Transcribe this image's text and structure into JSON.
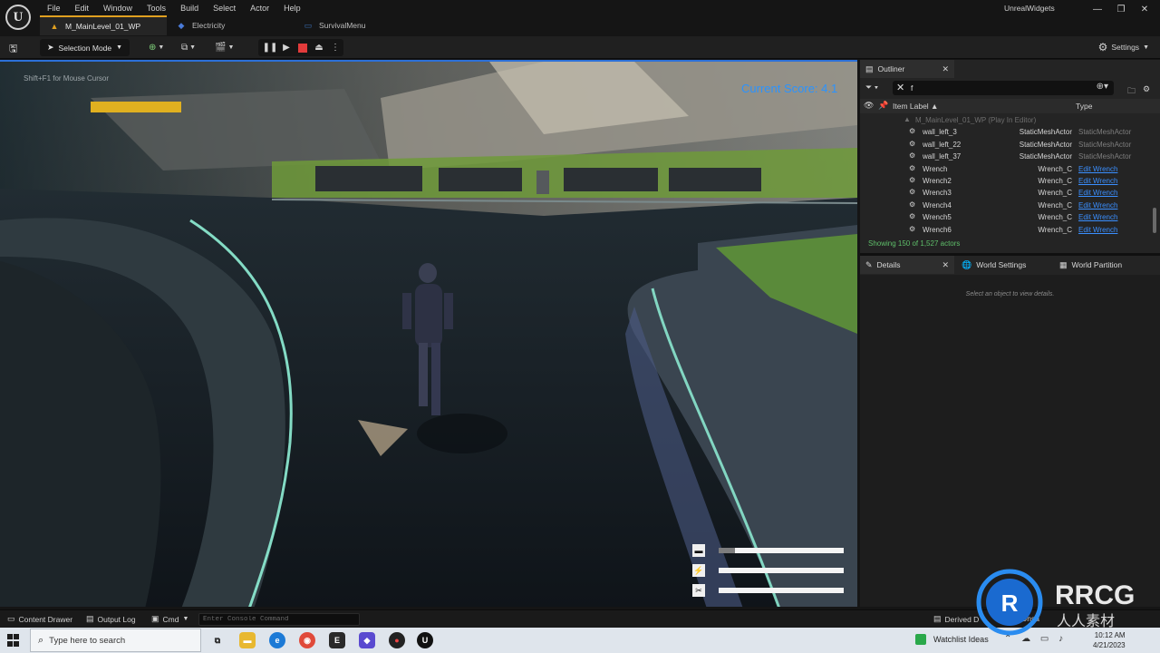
{
  "titlebar": {
    "logo": "U",
    "menu": [
      "File",
      "Edit",
      "Window",
      "Tools",
      "Build",
      "Select",
      "Actor",
      "Help"
    ],
    "tabs": [
      {
        "label": "M_MainLevel_01_WP",
        "icon": "level-icon",
        "active": true
      },
      {
        "label": "Electricity",
        "icon": "blueprint-icon",
        "active": false
      },
      {
        "label": "SurvivalMenu",
        "icon": "widget-icon",
        "active": false
      }
    ],
    "window_title": "UnrealWidgets",
    "window_buttons": [
      "—",
      "❐",
      "✕"
    ]
  },
  "toolbar": {
    "selection_mode_label": "Selection Mode",
    "settings_label": "Settings"
  },
  "viewport": {
    "hint": "Shift+F1 for Mouse Cursor",
    "score": "Current Score: 4.1",
    "hud_bars": [
      {
        "icon": "battery-icon",
        "glyph": "▬",
        "level": 0.13
      },
      {
        "icon": "lightning-icon",
        "glyph": "⚡",
        "level": 0.0
      },
      {
        "icon": "tools-icon",
        "glyph": "✂",
        "level": 0.0
      }
    ]
  },
  "outliner": {
    "tab_label": "Outliner",
    "search_value": "f",
    "columns": {
      "label": "Item Label ▲",
      "type": "Type"
    },
    "root": "M_MainLevel_01_WP (Play In Editor)",
    "rows": [
      {
        "name": "wall_left_3",
        "class": "StaticMeshActor",
        "type": "StaticMeshActor",
        "link": false
      },
      {
        "name": "wall_left_22",
        "class": "StaticMeshActor",
        "type": "StaticMeshActor",
        "link": false
      },
      {
        "name": "wall_left_37",
        "class": "StaticMeshActor",
        "type": "StaticMeshActor",
        "link": false
      },
      {
        "name": "Wrench",
        "class": "Wrench_C",
        "type": "Edit Wrench",
        "link": true
      },
      {
        "name": "Wrench2",
        "class": "Wrench_C",
        "type": "Edit Wrench",
        "link": true
      },
      {
        "name": "Wrench3",
        "class": "Wrench_C",
        "type": "Edit Wrench",
        "link": true
      },
      {
        "name": "Wrench4",
        "class": "Wrench_C",
        "type": "Edit Wrench",
        "link": true
      },
      {
        "name": "Wrench5",
        "class": "Wrench_C",
        "type": "Edit Wrench",
        "link": true
      },
      {
        "name": "Wrench6",
        "class": "Wrench_C",
        "type": "Edit Wrench",
        "link": true
      }
    ],
    "showing": "Showing 150 of 1,527 actors"
  },
  "details": {
    "tabs": [
      "Details",
      "World Settings",
      "World Partition"
    ],
    "empty_text": "Select an object to view details."
  },
  "statusbar": {
    "content_drawer": "Content Drawer",
    "output_log": "Output Log",
    "cmd": "Cmd",
    "console_placeholder": "Enter Console Command",
    "derived_data": "Derived D",
    "unsaved": "3 Unsa"
  },
  "taskbar": {
    "search_placeholder": "Type here to search",
    "watchlist": "Watchlist Ideas",
    "time": "10:12 AM",
    "date": "4/21/2023"
  },
  "colors": {
    "accent_blue": "#2c70d8",
    "score_blue": "#2a93ff",
    "stop_red": "#e23b3b",
    "link_blue": "#3a8fff",
    "status_green": "#5fbf6a"
  },
  "watermark": {
    "text": "RRCG",
    "subtext": "人人素材"
  }
}
